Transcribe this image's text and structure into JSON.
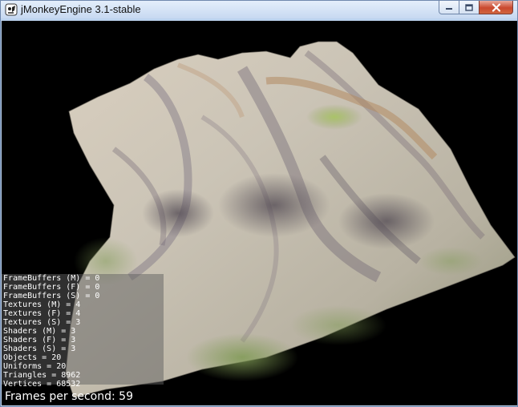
{
  "window": {
    "title": "jMonkeyEngine 3.1-stable",
    "icon": "jmonkey-app-icon",
    "buttons": {
      "minimize_icon": "minimize-icon",
      "maximize_icon": "maximize-icon",
      "close_icon": "close-icon"
    }
  },
  "scene": {
    "background_color": "#000000",
    "content": "textured 3d terrain mesh"
  },
  "stats": [
    "FrameBuffers (M) = 0",
    "FrameBuffers (F) = 0",
    "FrameBuffers (S) = 0",
    "Textures (M) = 4",
    "Textures (F) = 4",
    "Textures (S) = 3",
    "Shaders (M) = 3",
    "Shaders (F) = 3",
    "Shaders (S) = 3",
    "Objects = 20",
    "Uniforms = 20",
    "Triangles = 8962",
    "Vertices = 68532"
  ],
  "fps_label": "Frames per second: 59"
}
